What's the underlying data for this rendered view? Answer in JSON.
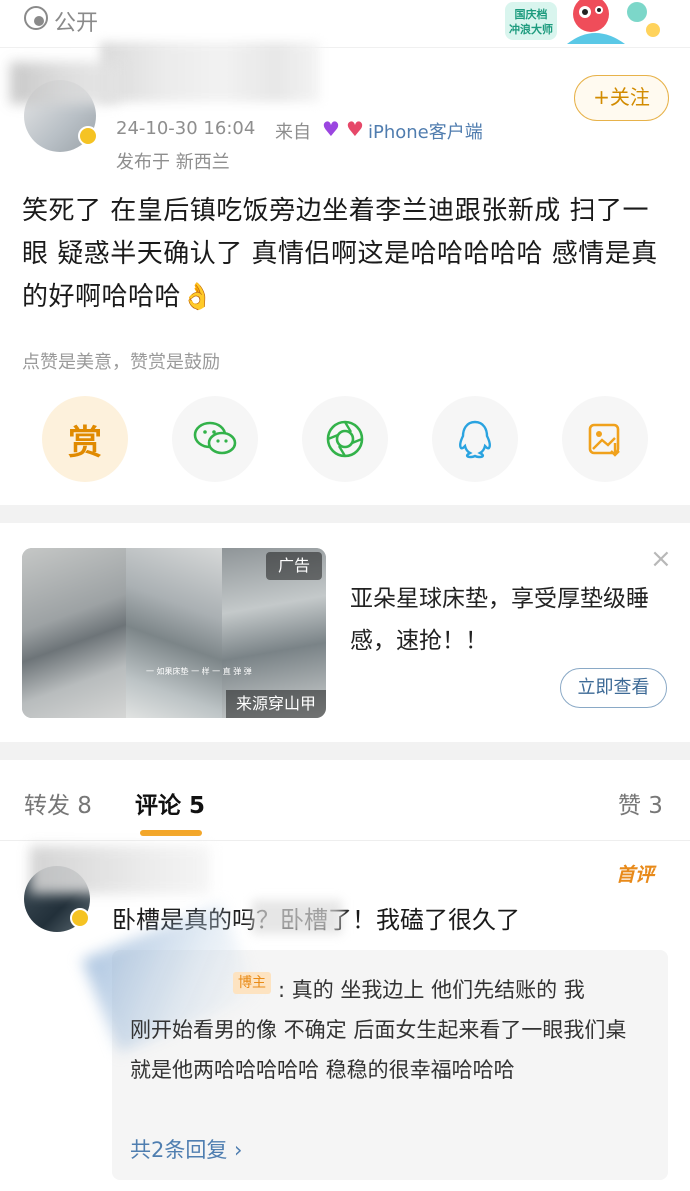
{
  "header": {
    "visibility_label": "公开",
    "festival_badge_line1": "国庆档",
    "festival_badge_line2": "冲浪大师"
  },
  "post": {
    "follow_label": "+关注",
    "time": "24-10-30 16:04",
    "source_prefix": "来自",
    "device": "iPhone客户端",
    "location": "发布于 新西兰",
    "body": "笑死了 在皇后镇吃饭旁边坐着李兰迪跟张新成 扫了一眼 疑惑半天确认了 真情侣啊这是哈哈哈哈哈 感情是真的好啊哈哈哈👌",
    "reward_hint": "点赞是美意，赞赏是鼓励"
  },
  "share": {
    "reward_label": "赏",
    "icons": [
      "wechat-icon",
      "moments-icon",
      "qq-icon",
      "save-image-icon"
    ]
  },
  "ad": {
    "badge": "广告",
    "source": "来源穿山甲",
    "close": "×",
    "title": "亚朵星球床垫，享受厚垫级睡感，速抢！！",
    "cta": "立即查看",
    "image_caption": "一 如果床垫 一 样 一 直 弹 弹"
  },
  "tabs": {
    "repost": "转发 8",
    "comments": "评论 5",
    "likes": "赞 3"
  },
  "comment": {
    "first_badge": "首评",
    "text": "卧槽是真的吗？卧槽了！我磕了很久了",
    "reply": {
      "author_badge": "博主",
      "text_first_line": ": 真的 坐我边上 他们先结账的 我",
      "text_rest": "刚开始看男的像 不确定 后面女生起来看了一眼我们桌 就是他两哈哈哈哈哈 稳稳的很幸福哈哈哈",
      "more_replies": "共2条回复 ›"
    }
  },
  "colors": {
    "accent_orange": "#f3a629",
    "link_blue": "#507daf",
    "verified_gold": "#f5c323"
  }
}
